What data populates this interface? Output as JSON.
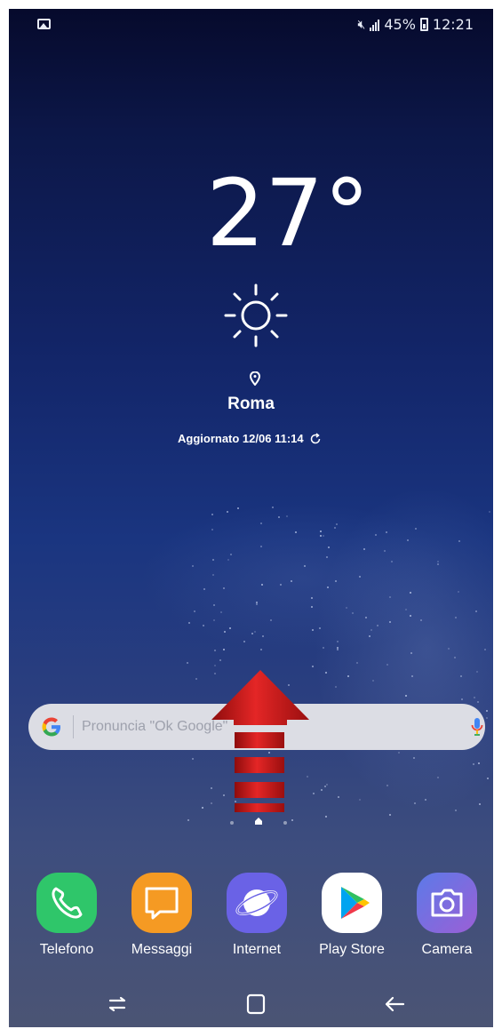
{
  "status_bar": {
    "battery_percent": "45%",
    "time": "12:21",
    "icons": [
      "gallery-icon",
      "mute-icon",
      "signal-icon",
      "battery-icon"
    ]
  },
  "weather": {
    "temperature": "27°",
    "condition_icon": "sun-icon",
    "city": "Roma",
    "updated": "Aggiornato 12/06 11:14"
  },
  "search": {
    "placeholder": "Pronuncia \"Ok Google\"",
    "icons": [
      "google-icon",
      "mic-icon"
    ]
  },
  "overlay": {
    "icon": "swipe-up-arrow-icon",
    "color": "#d01818"
  },
  "dock": {
    "apps": [
      {
        "label": "Telefono",
        "icon": "phone-icon",
        "color": "#2fc66a"
      },
      {
        "label": "Messaggi",
        "icon": "message-icon",
        "color": "#f59a23"
      },
      {
        "label": "Internet",
        "icon": "internet-icon",
        "color": "#6a62e6"
      },
      {
        "label": "Play Store",
        "icon": "play-store-icon",
        "color": "#ffffff"
      },
      {
        "label": "Camera",
        "icon": "camera-icon",
        "color": "#7b66d9"
      }
    ]
  },
  "navbar": {
    "icons": [
      "recent-apps-icon",
      "home-icon",
      "back-icon"
    ]
  }
}
